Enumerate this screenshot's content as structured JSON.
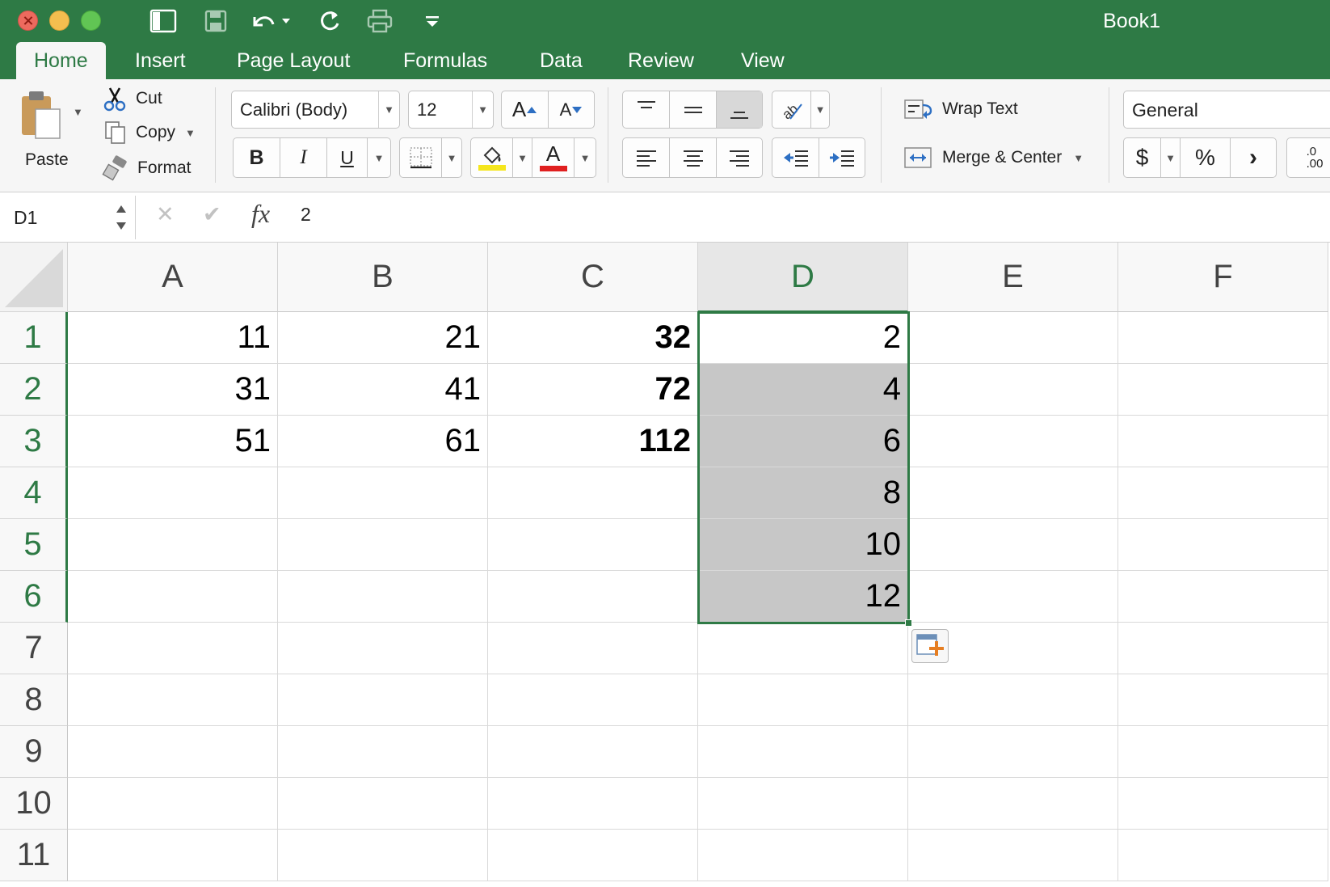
{
  "window": {
    "title": "Book1"
  },
  "quick_access": [
    {
      "name": "sidebar-toggle-icon"
    },
    {
      "name": "save-icon"
    },
    {
      "name": "undo-icon"
    },
    {
      "name": "redo-icon"
    },
    {
      "name": "print-icon"
    },
    {
      "name": "customize-toolbar-icon"
    }
  ],
  "tabs": [
    "Home",
    "Insert",
    "Page Layout",
    "Formulas",
    "Data",
    "Review",
    "View"
  ],
  "active_tab": "Home",
  "clipboard": {
    "paste_label": "Paste",
    "cut_label": "Cut",
    "copy_label": "Copy",
    "format_label": "Format"
  },
  "font": {
    "family": "Calibri (Body)",
    "size": "12",
    "grow_label": "A",
    "shrink_label": "A",
    "bold_label": "B",
    "italic_label": "I",
    "underline_label": "U",
    "color_label": "A",
    "highlight_color": "#f5e61d",
    "font_color": "#e02020"
  },
  "alignment": {
    "wrap_text_label": "Wrap Text",
    "merge_center_label": "Merge & Center"
  },
  "number": {
    "format": "General",
    "currency_label": "$",
    "percent_label": "%",
    "comma_label": "›",
    "increase_decimal_label": ".0\n.00"
  },
  "formula_bar": {
    "name_box": "D1",
    "cancel_label": "✕",
    "enter_label": "✔",
    "fx_label": "fx",
    "value": "2"
  },
  "sheet": {
    "columns": [
      "A",
      "B",
      "C",
      "D",
      "E",
      "F"
    ],
    "rows": [
      "1",
      "2",
      "3",
      "4",
      "5",
      "6",
      "7",
      "8",
      "9",
      "10",
      "11"
    ],
    "selected_column": "D",
    "selected_range": "D1:D6",
    "cells": {
      "A": [
        "11",
        "31",
        "51",
        "",
        "",
        "",
        "",
        "",
        "",
        "",
        ""
      ],
      "B": [
        "21",
        "41",
        "61",
        "",
        "",
        "",
        "",
        "",
        "",
        "",
        ""
      ],
      "C": [
        "32",
        "72",
        "112",
        "",
        "",
        "",
        "",
        "",
        "",
        "",
        ""
      ],
      "D": [
        "2",
        "4",
        "6",
        "8",
        "10",
        "12",
        "",
        "",
        "",
        "",
        ""
      ],
      "E": [
        "",
        "",
        "",
        "",
        "",
        "",
        "",
        "",
        "",
        "",
        ""
      ],
      "F": [
        "",
        "",
        "",
        "",
        "",
        "",
        "",
        "",
        "",
        "",
        ""
      ]
    },
    "bold_columns": [
      "C"
    ],
    "accent_color": "#2e7a45"
  }
}
